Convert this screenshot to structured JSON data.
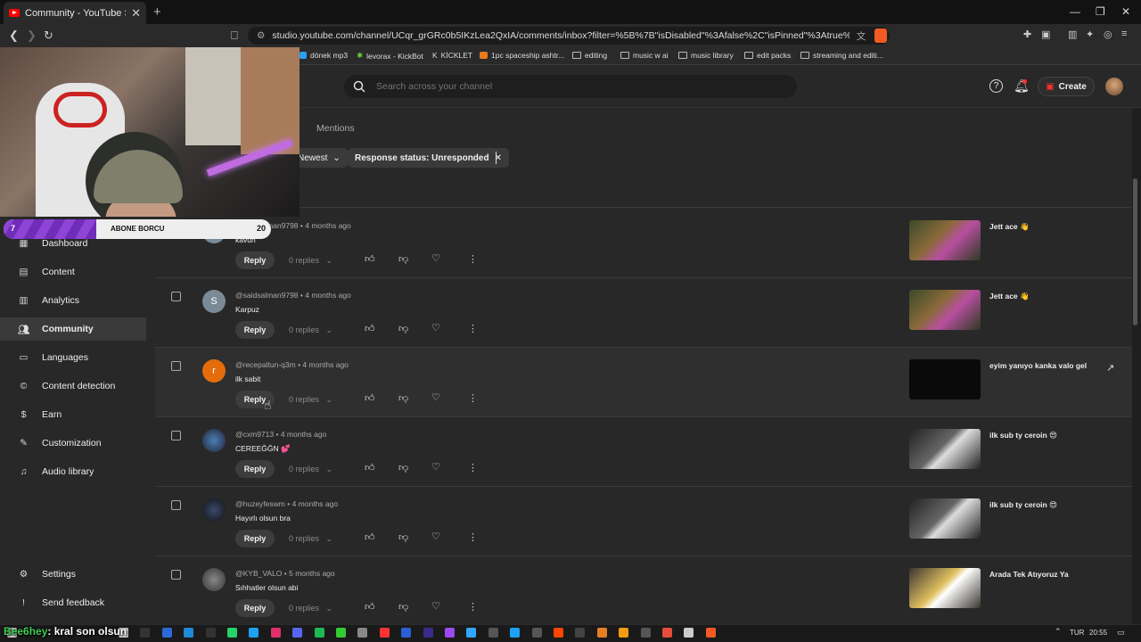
{
  "browser": {
    "tab_title": "Community - YouTube Studio",
    "url": "studio.youtube.com/channel/UCqr_grGRc0b5IKzLea2QxIA/comments/inbox?filter=%5B%7B\"isDisabled\"%3Afalse%2C\"isPinned\"%3Atrue%2C\"name\"...",
    "bookmarks": [
      "dönek mp3",
      "levorax - KickBot",
      "KİCKLET",
      "1pc spaceship ashtr...",
      "editing",
      "music w ai",
      "music library",
      "edit packs",
      "streaming and editi..."
    ]
  },
  "header": {
    "search_placeholder": "Search across your channel",
    "create_label": "Create"
  },
  "sidebar": {
    "items": [
      {
        "label": "Dashboard",
        "icon": "dashboard-icon"
      },
      {
        "label": "Content",
        "icon": "content-icon"
      },
      {
        "label": "Analytics",
        "icon": "analytics-icon"
      },
      {
        "label": "Community",
        "icon": "community-icon",
        "active": true
      },
      {
        "label": "Languages",
        "icon": "languages-icon"
      },
      {
        "label": "Content detection",
        "icon": "copyright-icon"
      },
      {
        "label": "Earn",
        "icon": "earn-icon"
      },
      {
        "label": "Customization",
        "icon": "customization-icon"
      },
      {
        "label": "Audio library",
        "icon": "audio-library-icon"
      }
    ],
    "settings_label": "Settings",
    "feedback_label": "Send feedback"
  },
  "tabs": {
    "mentions": "Mentions"
  },
  "filters": {
    "sort_label": "Newest",
    "response_status": "Response status: Unresponded"
  },
  "comments": [
    {
      "author": "@saidsalman9798",
      "time": "4 months ago",
      "text": "kavun",
      "avatar_letter": "S",
      "replies": "0 replies",
      "video_title": "Jett ace 👋"
    },
    {
      "author": "@saidsalman9798",
      "time": "4 months ago",
      "text": "Karpuz",
      "avatar_letter": "S",
      "replies": "0 replies",
      "video_title": "Jett ace 👋"
    },
    {
      "author": "@recepaltun-q3m",
      "time": "4 months ago",
      "text": "ilk sabit",
      "avatar_letter": "r",
      "replies": "0 replies",
      "video_title": "eyim yanıyo kanka valo gel"
    },
    {
      "author": "@cxm9713",
      "time": "4 months ago",
      "text": "CEREEĞĞN 💕",
      "avatar_letter": "",
      "replies": "0 replies",
      "video_title": "ilk sub ty ceroin 😍"
    },
    {
      "author": "@huzeyfeswm",
      "time": "4 months ago",
      "text": "Hayırlı olsun bra",
      "avatar_letter": "",
      "replies": "0 replies",
      "video_title": "ilk sub ty ceroin 😍"
    },
    {
      "author": "@KYB_VALO",
      "time": "5 months ago",
      "text": "Sıhhatler olsun abi",
      "avatar_letter": "",
      "replies": "0 replies",
      "video_title": "Arada Tek Atıyoruz Ya"
    }
  ],
  "reply_label": "Reply",
  "overlay": {
    "sub_count": "7",
    "sub_label": "ABONE BORCU",
    "sub_goal": "20",
    "chat_user": "Bee6hey",
    "chat_text": ": kral son olsun"
  },
  "taskbar": {
    "lang": "TUR",
    "time": "20:55"
  },
  "colors": {
    "accent_red": "#ff0000",
    "overlay_purple": "#8e44d6",
    "chat_green": "#3fcb52"
  }
}
